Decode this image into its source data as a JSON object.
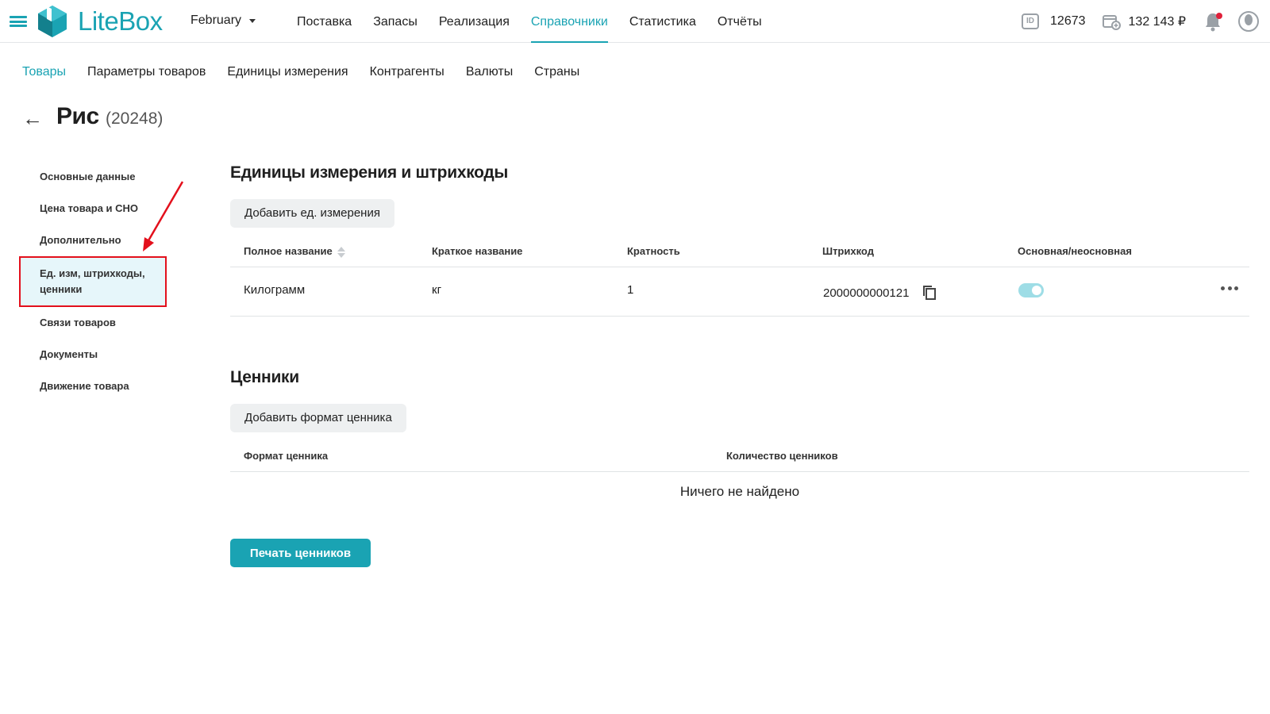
{
  "header": {
    "logo_text": "LiteBox",
    "month": "February",
    "nav": [
      {
        "label": "Поставка"
      },
      {
        "label": "Запасы"
      },
      {
        "label": "Реализация"
      },
      {
        "label": "Справочники",
        "active": true
      },
      {
        "label": "Статистика"
      },
      {
        "label": "Отчёты"
      }
    ],
    "id_icon_text": "ID",
    "id_value": "12673",
    "balance": "132 143 ₽",
    "icons": [
      "menu-icon",
      "logo-icon",
      "id-icon",
      "wallet-icon",
      "bell-icon",
      "user-icon"
    ],
    "accent_color": "#1aa3b3",
    "notification_color": "#e0203a"
  },
  "subnav": [
    {
      "label": "Товары",
      "active": true
    },
    {
      "label": "Параметры товаров"
    },
    {
      "label": "Единицы измерения"
    },
    {
      "label": "Контрагенты"
    },
    {
      "label": "Валюты"
    },
    {
      "label": "Страны"
    }
  ],
  "page": {
    "back_arrow": "←",
    "title": "Рис",
    "title_id": "(20248)"
  },
  "sidemenu": [
    {
      "label": "Основные данные"
    },
    {
      "label": "Цена товара и СНО"
    },
    {
      "label": "Дополнительно"
    },
    {
      "label": "Ед. изм, штрихкоды, ценники",
      "active": true
    },
    {
      "label": "Связи товаров"
    },
    {
      "label": "Документы"
    },
    {
      "label": "Движение товара"
    }
  ],
  "units": {
    "title": "Единицы измерения и штрихкоды",
    "add_button": "Добавить ед. измерения",
    "columns": [
      "Полное название",
      "Краткое название",
      "Кратность",
      "Штрихкод",
      "Основная/неосновная"
    ],
    "rows": [
      {
        "full_name": "Килограмм",
        "short_name": "кг",
        "multiplicity": "1",
        "barcode": "2000000000121",
        "is_main": true
      }
    ]
  },
  "price_tags": {
    "title": "Ценники",
    "add_button": "Добавить формат ценника",
    "columns": [
      "Формат ценника",
      "Количество ценников"
    ],
    "empty_text": "Ничего не найдено",
    "print_button": "Печать ценников"
  },
  "annotation": {
    "highlight_color": "#e3101c"
  }
}
